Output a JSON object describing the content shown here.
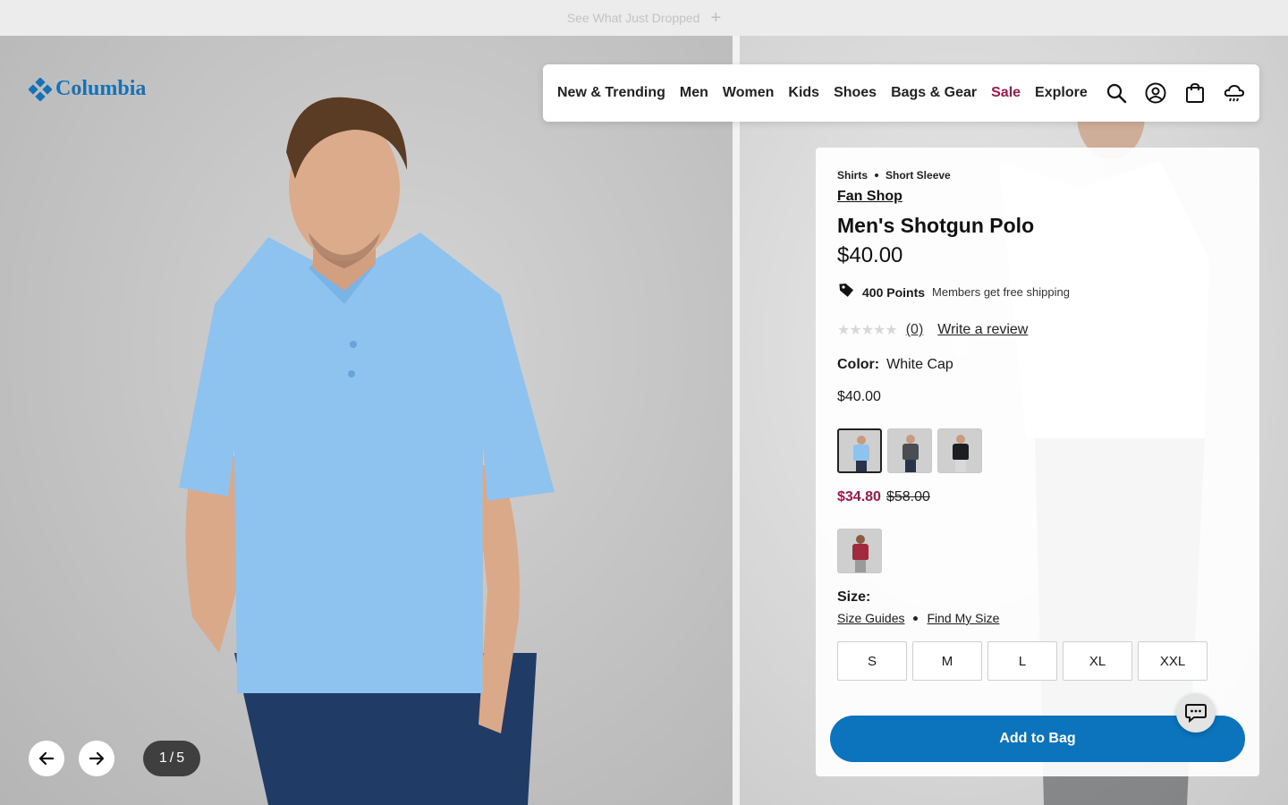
{
  "promo": {
    "text": "See What Just Dropped",
    "expand_icon": "plus-icon"
  },
  "brand": {
    "name": "Columbia",
    "logo_color": "#1572b8"
  },
  "nav": {
    "links": [
      "New & Trending",
      "Men",
      "Women",
      "Kids",
      "Shoes",
      "Bags & Gear",
      "Sale",
      "Explore"
    ],
    "icons": [
      "search-icon",
      "account-icon",
      "bag-icon",
      "weather-icon"
    ]
  },
  "product": {
    "breadcrumbs": [
      "Shirts",
      "Short Sleeve"
    ],
    "collection": "Fan Shop",
    "title": "Men's Shotgun Polo",
    "price": "$40.00",
    "points": "400 Points",
    "points_note": "Members get free shipping",
    "rating_stars": 0,
    "review_count": "(0)",
    "write_review": "Write a review",
    "color_label": "Color:",
    "color_value": "White Cap",
    "variant_price": "$40.00",
    "swatches": [
      {
        "name": "light-blue",
        "color": "#8ec2ef",
        "selected": true
      },
      {
        "name": "charcoal",
        "color": "#4a4d52",
        "selected": false
      },
      {
        "name": "black",
        "color": "#1d1e21",
        "selected": false
      }
    ],
    "sale_price": "$34.80",
    "original_price": "$58.00",
    "sale_swatches": [
      {
        "name": "red",
        "color": "#a02b3e"
      }
    ],
    "size_label": "Size:",
    "size_guides": "Size Guides",
    "find_my_size": "Find My Size",
    "sizes": [
      "S",
      "M",
      "L",
      "XL",
      "XXL"
    ],
    "add_to_bag": "Add to Bag",
    "sale_color": "#a1174a",
    "button_color": "#0b74bd"
  },
  "gallery": {
    "current": "1",
    "separator": "/",
    "total": "5"
  }
}
